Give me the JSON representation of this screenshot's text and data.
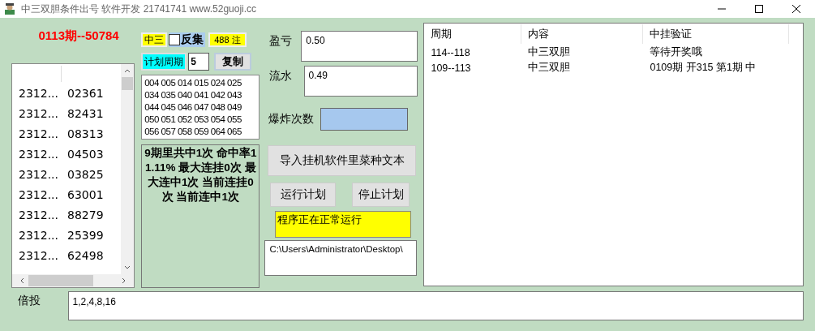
{
  "window": {
    "title": "中三双胆条件出号 软件开发 21741741 www.52guoji.cc"
  },
  "current_draw": "0113期--50784",
  "history": {
    "rows": [
      {
        "period": "2312...",
        "number": "02361"
      },
      {
        "period": "2312...",
        "number": "82431"
      },
      {
        "period": "2312...",
        "number": "08313"
      },
      {
        "period": "2312...",
        "number": "04503"
      },
      {
        "period": "2312...",
        "number": "03825"
      },
      {
        "period": "2312...",
        "number": "63001"
      },
      {
        "period": "2312...",
        "number": "88279"
      },
      {
        "period": "2312...",
        "number": "25399"
      },
      {
        "period": "2312...",
        "number": "62498"
      }
    ]
  },
  "plan": {
    "mode": "中三",
    "reverse_set": {
      "label": "反集",
      "checked": false
    },
    "count": "488 注",
    "period_label": "计划周期",
    "period_value": "5",
    "copy_button": "复制",
    "numbers": "004 005 014 015 024 025\n034 035 040 041 042 043\n044 045 046 047 048 049\n050 051 052 053 054 055\n056 057 058 059 064 065",
    "summary": "9期里共中1次 命中率11.11% 最大连挂0次 最大连中1次 当前连挂0次 当前连中1次"
  },
  "profit": {
    "label": "盈亏",
    "value": "0.50"
  },
  "turnover": {
    "label": "流水",
    "value": "0.49"
  },
  "explosions": {
    "label": "爆炸次数"
  },
  "import_button": "导入挂机软件里菜种文本",
  "run_button": "运行计划",
  "stop_button": "停止计划",
  "status": "程序正在正常运行",
  "path": "C:\\Users\\Administrator\\Desktop\\",
  "table": {
    "columns": [
      "周期",
      "内容",
      "中挂验证"
    ],
    "rows": [
      [
        "114--118",
        "中三双胆",
        "等待开奖哦"
      ],
      [
        "109--113",
        "中三双胆",
        "0109期 开315 第1期 中"
      ]
    ]
  },
  "multiplier": {
    "label": "倍投",
    "value": "1,2,4,8,16"
  }
}
